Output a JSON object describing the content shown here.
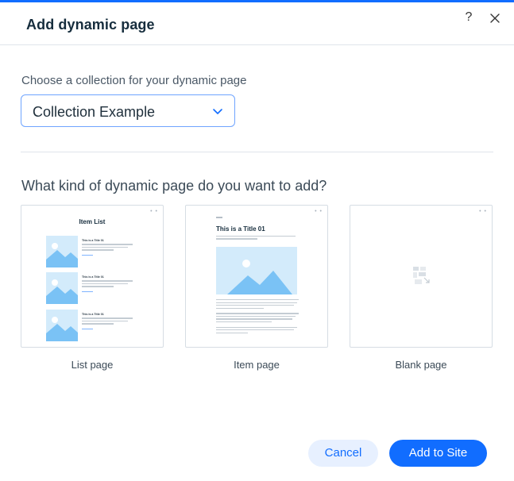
{
  "dialog": {
    "title": "Add dynamic page",
    "help_label": "?",
    "close_icon": "close-icon",
    "accent_color": "#116dff"
  },
  "collection": {
    "label": "Choose a collection for your dynamic page",
    "selected": "Collection Example",
    "icon": "chevron-down-icon"
  },
  "page_type": {
    "question": "What kind of dynamic page do you want to add?",
    "cards": [
      {
        "label": "List page",
        "preview_title": "Item List",
        "row_title": "This is a Title 01"
      },
      {
        "label": "Item page",
        "preview_title": "This is a Title 01"
      },
      {
        "label": "Blank page",
        "icon": "blank-page-icon"
      }
    ],
    "window_dots": "• •"
  },
  "footer": {
    "cancel_label": "Cancel",
    "add_label": "Add to Site"
  }
}
